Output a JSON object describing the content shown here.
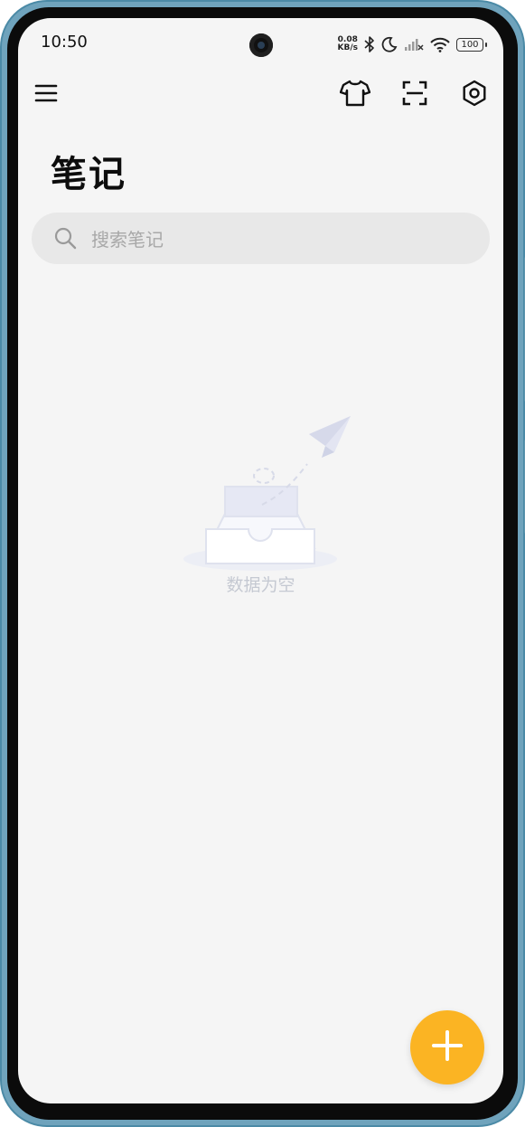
{
  "status_bar": {
    "time": "10:50",
    "net_speed_value": "0.08",
    "net_speed_unit": "KB/s",
    "battery": "100",
    "icons": [
      "bluetooth-icon",
      "moon-icon",
      "signal-off-icon",
      "wifi-icon",
      "battery-icon"
    ]
  },
  "toolbar": {
    "icons": [
      "menu-icon",
      "tshirt-icon",
      "scan-icon",
      "settings-icon"
    ]
  },
  "page": {
    "title": "笔记"
  },
  "search": {
    "placeholder": "搜索笔记",
    "value": ""
  },
  "empty_state": {
    "message": "数据为空"
  },
  "fab": {
    "icon": "plus-icon",
    "color": "#fbb423"
  },
  "colors": {
    "background": "#f5f5f5",
    "accent": "#fbb423",
    "search_bg": "#e8e8e8"
  }
}
